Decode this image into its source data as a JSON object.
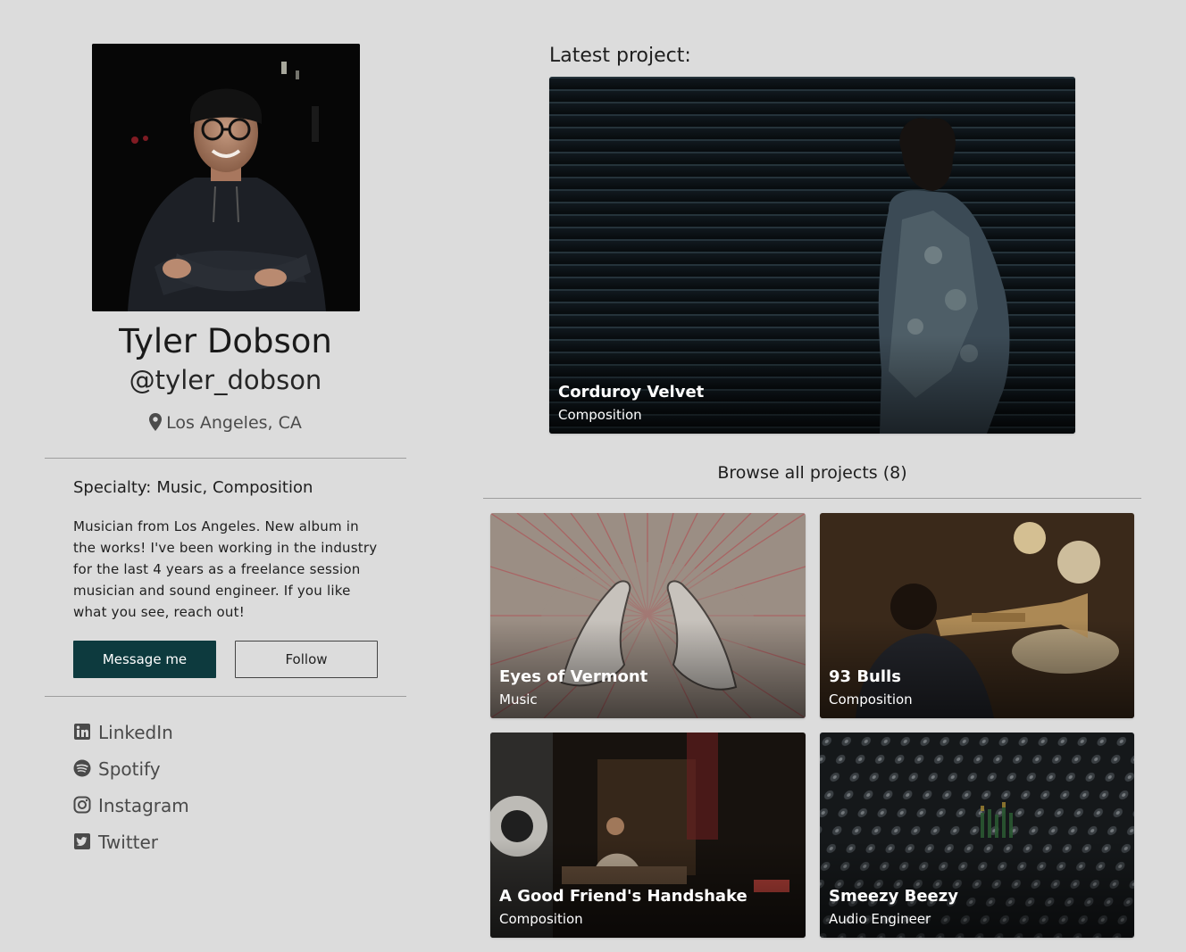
{
  "profile": {
    "name": "Tyler Dobson",
    "handle": "@tyler_dobson",
    "location": "Los Angeles, CA",
    "specialty_label": "Specialty:",
    "specialty_value": "Music, Composition",
    "bio": "Musician from Los Angeles. New album in the works! I've been working in the industry for the last 4 years as a freelance session musician and sound engineer. If you like what you see, reach out!"
  },
  "actions": {
    "message_label": "Message me",
    "follow_label": "Follow"
  },
  "social": [
    {
      "label": "LinkedIn",
      "icon": "linkedin-icon"
    },
    {
      "label": "Spotify",
      "icon": "spotify-icon"
    },
    {
      "label": "Instagram",
      "icon": "instagram-icon"
    },
    {
      "label": "Twitter",
      "icon": "twitter-icon"
    }
  ],
  "latest": {
    "heading": "Latest project:",
    "title": "Corduroy Velvet",
    "category": "Composition"
  },
  "browse": {
    "label": "Browse all projects (8)"
  },
  "projects": [
    {
      "title": "Eyes of Vermont",
      "category": "Music"
    },
    {
      "title": "93 Bulls",
      "category": "Composition"
    },
    {
      "title": "A Good Friend's Handshake",
      "category": "Composition"
    },
    {
      "title": "Smeezy Beezy",
      "category": "Audio Engineer"
    }
  ],
  "colors": {
    "background": "#dcdcdc",
    "primary_button": "#0d3a3e",
    "text": "#1e1e1e",
    "muted_text": "#4a4a4a"
  }
}
